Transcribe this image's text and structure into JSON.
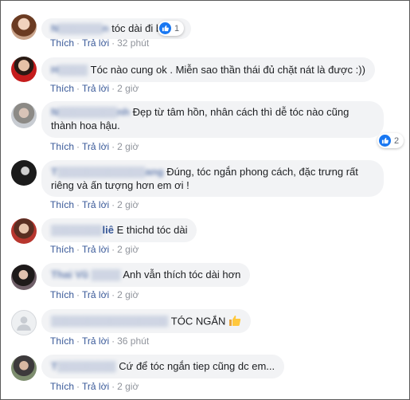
{
  "labels": {
    "like": "Thích",
    "reply": "Trả lời"
  },
  "comments": [
    {
      "name": "N▒▒▒▒▒▒n",
      "text": "tóc dài đi bà",
      "time": "32 phút",
      "reactions": "1"
    },
    {
      "name": "H▒▒▒▒",
      "text": "Tóc nào cung ok . Miễn sao thần thái đủ chặt nát là được :))",
      "time": "2 giờ"
    },
    {
      "name": "N▒▒▒▒▒▒▒▒nh",
      "text": "Đẹp từ tâm hồn, nhân cách thì dễ tóc nào cũng thành hoa hậu.",
      "time": "2 giờ",
      "reactions": "2"
    },
    {
      "name": "T▒▒▒▒▒▒▒▒▒▒▒▒ang",
      "text": "Đúng, tóc ngắn phong cách, đặc trưng rất riêng và ấn tượng hơn em ơi !",
      "time": "2 giờ"
    },
    {
      "name": "▒▒▒▒▒▒▒",
      "name_suffix": "liê",
      "text": "E thichd tóc dài",
      "time": "2 giờ"
    },
    {
      "name": "Thai Vũ ▒▒▒▒",
      "text": "Anh vẫn thích tóc dài hơn",
      "time": "2 giờ"
    },
    {
      "name": "▒▒▒▒▒▒▒▒▒▒▒▒▒▒▒▒",
      "text": "TÓC NGẮN",
      "time": "36 phút"
    },
    {
      "name": "T▒▒▒▒▒▒▒▒",
      "text": "Cứ để tóc ngắn tiep cũng dc em...",
      "time": "2 giờ"
    }
  ]
}
